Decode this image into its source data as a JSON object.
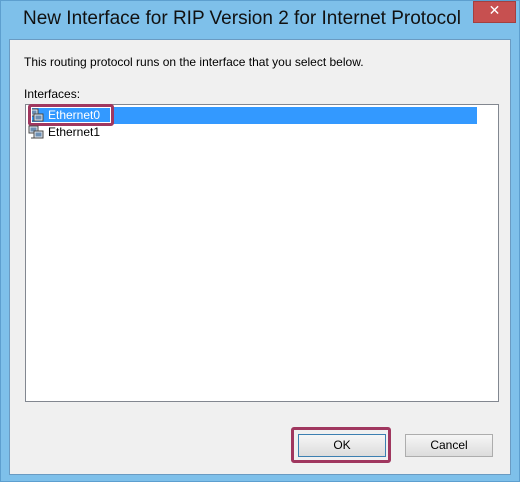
{
  "window": {
    "title": "New Interface for RIP Version 2 for Internet Protocol",
    "close_glyph": "✕"
  },
  "dialog": {
    "description": "This routing protocol runs on the interface that you select below.",
    "interfaces_label": "Interfaces:",
    "interfaces": [
      {
        "label": "Ethernet0",
        "icon": "network-interface-icon",
        "selected": true
      },
      {
        "label": "Ethernet1",
        "icon": "network-interface-icon",
        "selected": false
      }
    ]
  },
  "buttons": {
    "ok_label": "OK",
    "cancel_label": "Cancel"
  },
  "colors": {
    "title_bar": "#7ec0ea",
    "selection": "#3399ff",
    "highlight_outline": "#a0375f",
    "close_button": "#c75050"
  }
}
